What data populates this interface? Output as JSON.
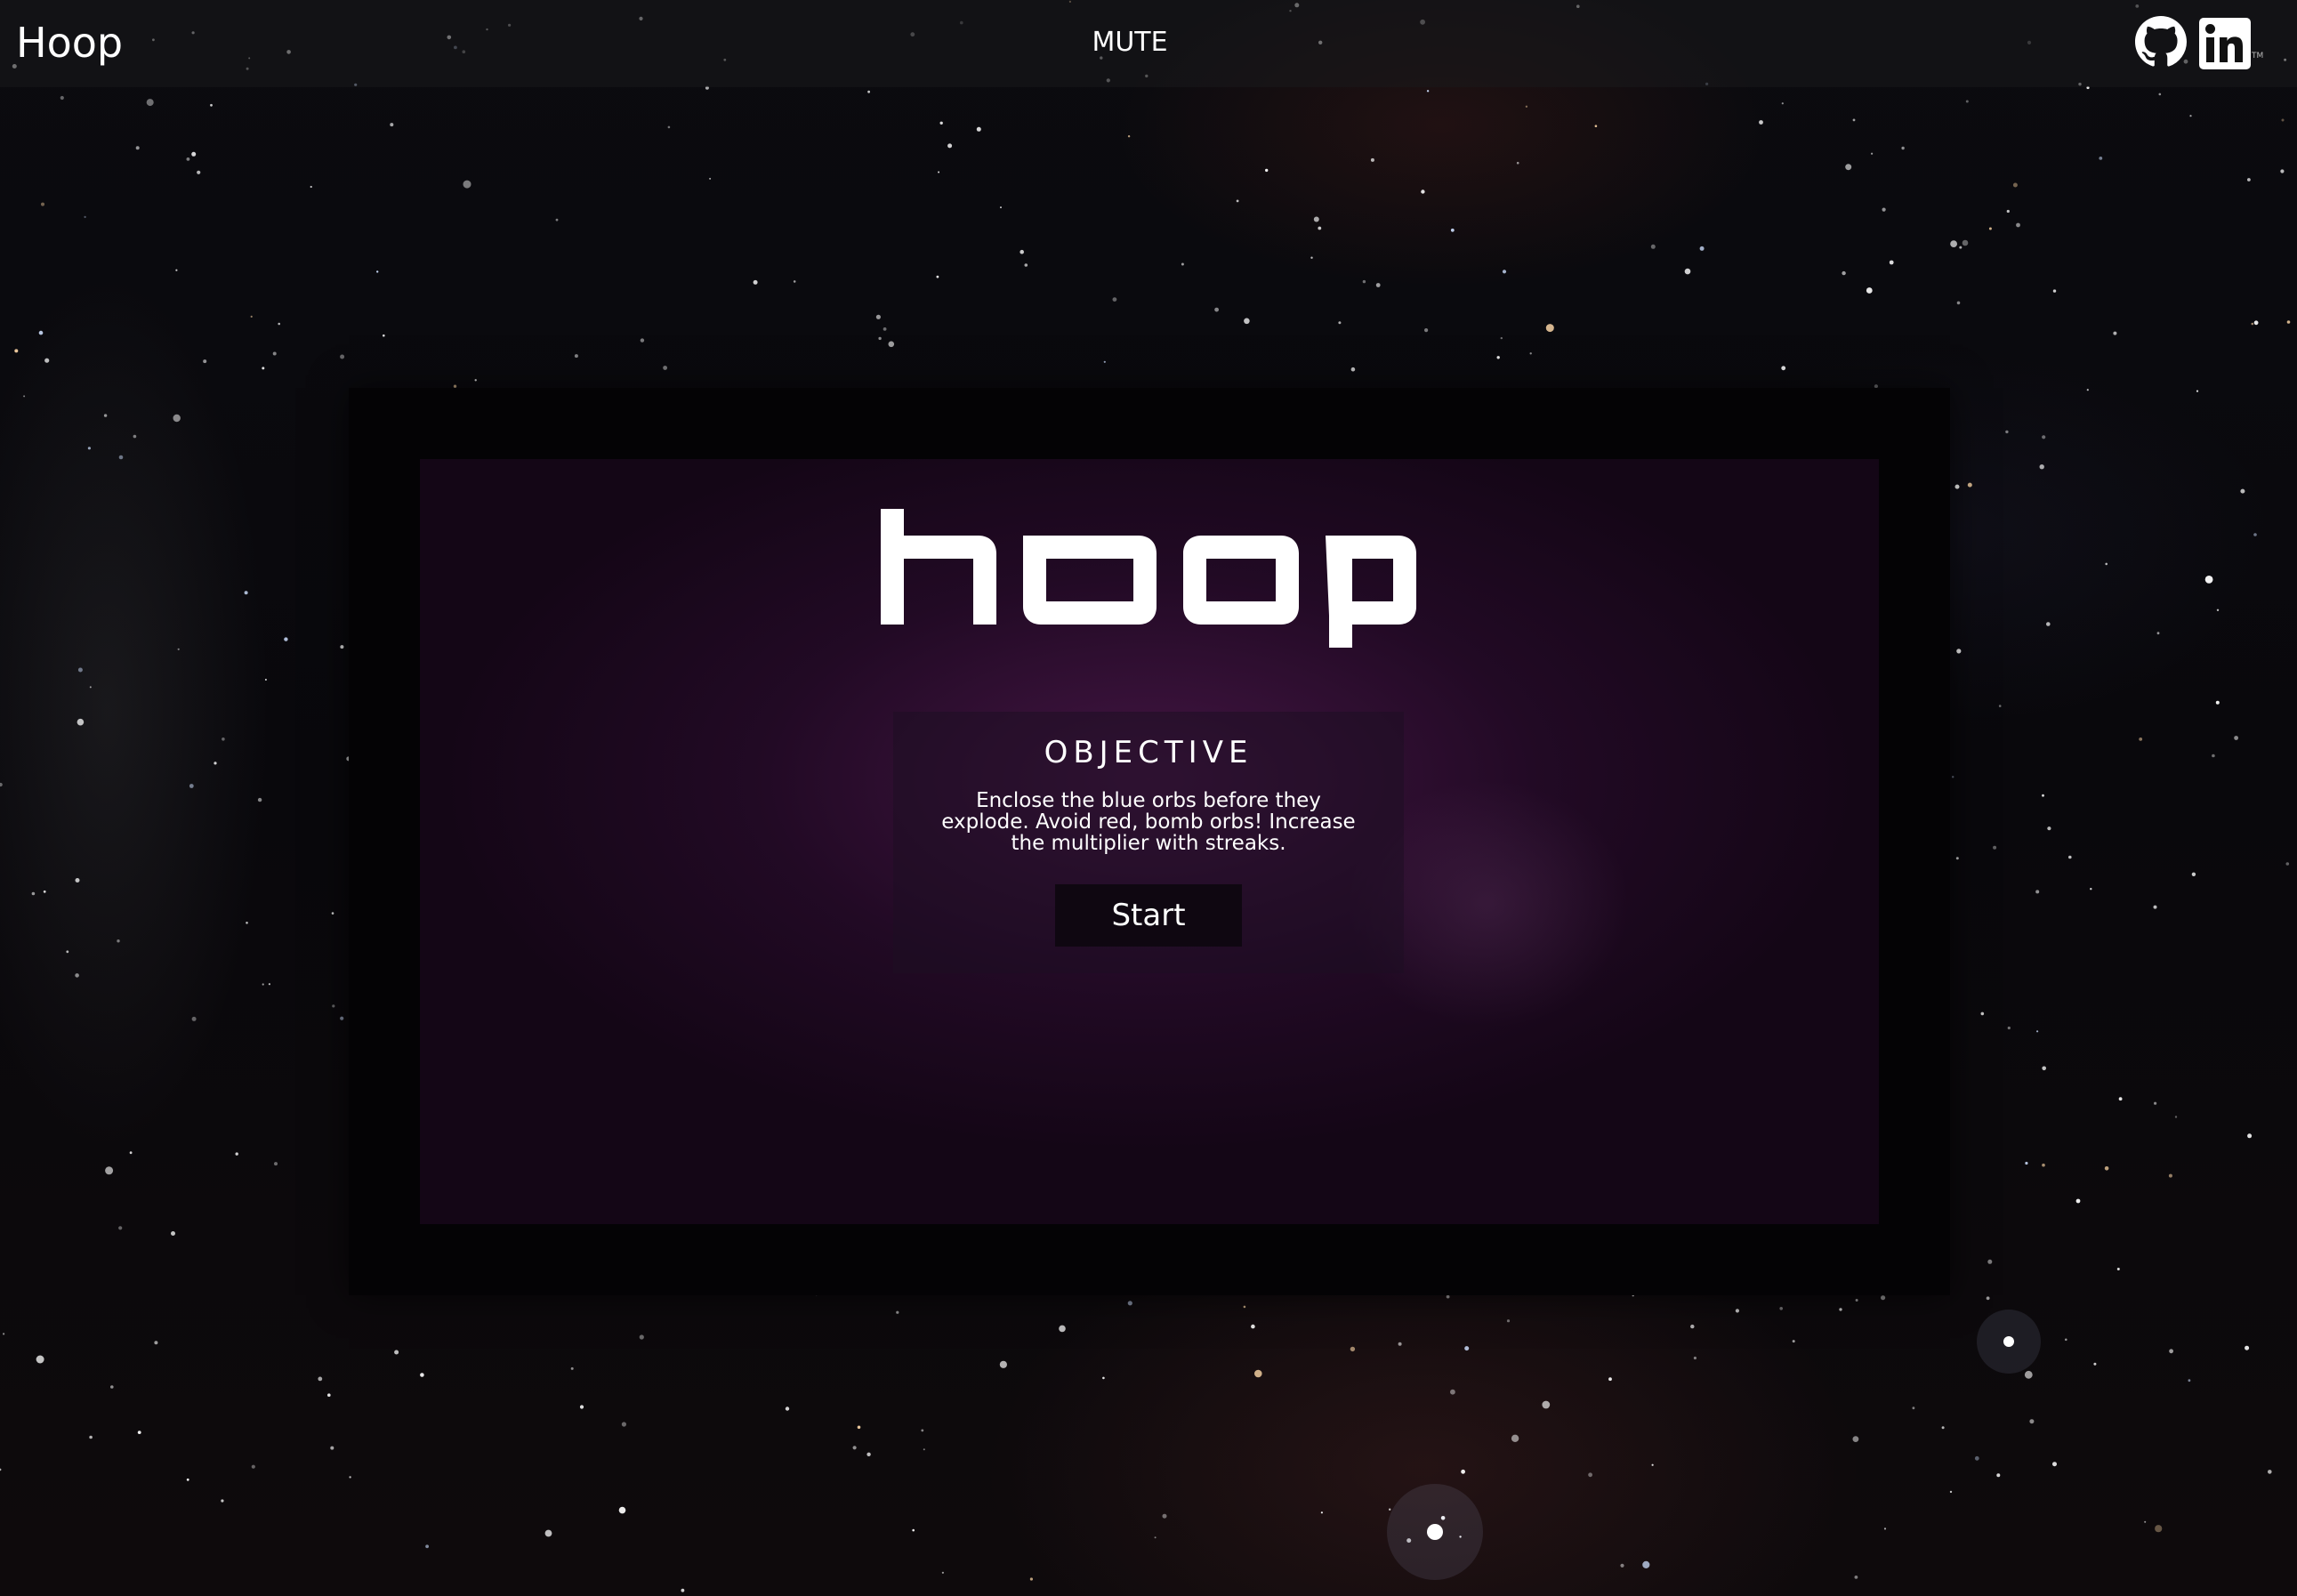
{
  "header": {
    "title": "Hoop",
    "mute_label": "MUTE",
    "links": [
      {
        "icon": "github-icon",
        "name": "GitHub"
      },
      {
        "icon": "linkedin-icon",
        "name": "LinkedIn"
      }
    ]
  },
  "game": {
    "logo_text": "hoop",
    "objective": {
      "heading": "OBJECTIVE",
      "text": "Enclose the blue orbs before they explode. Avoid red, bomb orbs! Increase the multiplier with streaks.",
      "start_label": "Start"
    }
  },
  "colors": {
    "canvas_purple": "#3a1240",
    "frame_black": "#040305",
    "button_bg": "#0f0711",
    "text": "#ffffff"
  }
}
